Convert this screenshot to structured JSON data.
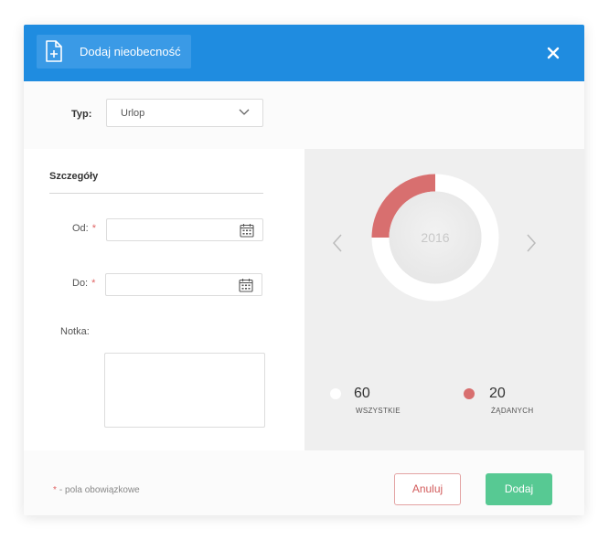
{
  "header": {
    "title": "Dodaj nieobecność",
    "close_icon": "close-icon",
    "title_icon": "document-add-icon",
    "color": "#1f8ce0"
  },
  "type_field": {
    "label": "Typ:",
    "value": "Urlop"
  },
  "details": {
    "title": "Szczegóły",
    "from_label": "Od:",
    "to_label": "Do:",
    "note_label": "Notka:",
    "required_mark": "*"
  },
  "stats": {
    "year": "2016",
    "all_count": "60",
    "all_label": "WSZYSTKIE",
    "requested_count": "20",
    "requested_label": "ŻĄDANYCH",
    "requested_fraction": 0.25,
    "requested_color": "#d86f6f",
    "all_color": "#ffffff"
  },
  "footer": {
    "required_note": "- pola obowiązkowe",
    "required_mark": "*",
    "cancel_label": "Anuluj",
    "add_label": "Dodaj",
    "add_color": "#57c993",
    "cancel_color": "#d25c5c"
  }
}
